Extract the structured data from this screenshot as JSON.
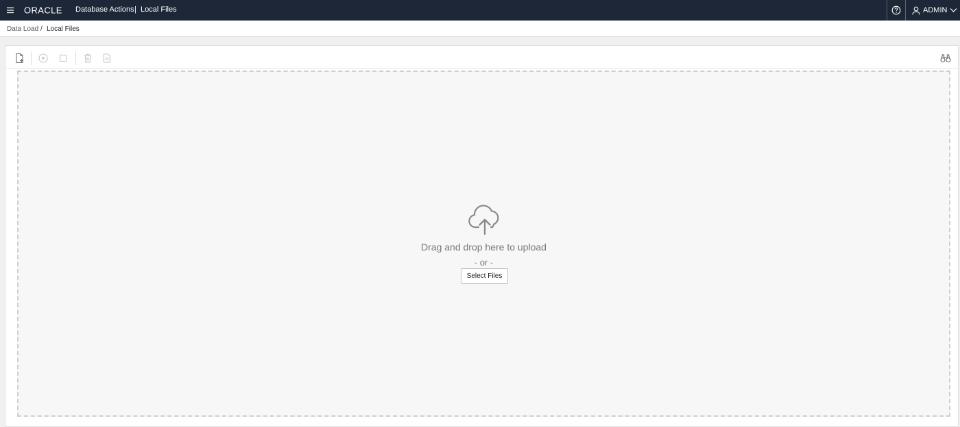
{
  "header": {
    "brand": "ORACLE",
    "app_title": "Database Actions",
    "separator": "|",
    "page_title": "Local Files",
    "user_name": "ADMIN"
  },
  "breadcrumb": {
    "items": [
      {
        "label": "Data Load"
      },
      {
        "label": "Local Files"
      }
    ],
    "separator": "/"
  },
  "dropzone": {
    "message": "Drag and drop here to upload",
    "or_text": "- or -",
    "select_button_label": "Select Files"
  },
  "icons": {
    "menu": "hamburger-icon",
    "help": "help-icon",
    "user": "user-icon",
    "chevron": "chevron-down-icon",
    "add": "add-file-icon",
    "run": "play-icon",
    "stop": "stop-icon",
    "delete": "trash-icon",
    "report": "document-icon",
    "find": "binoculars-icon",
    "upload": "cloud-upload-icon"
  },
  "colors": {
    "header_bg": "#1d2737",
    "page_bg": "#f0f0f0",
    "dropzone_bg": "#f7f7f7",
    "dropzone_border": "#cfcfcf",
    "icon_gray": "#8a8a8a"
  }
}
